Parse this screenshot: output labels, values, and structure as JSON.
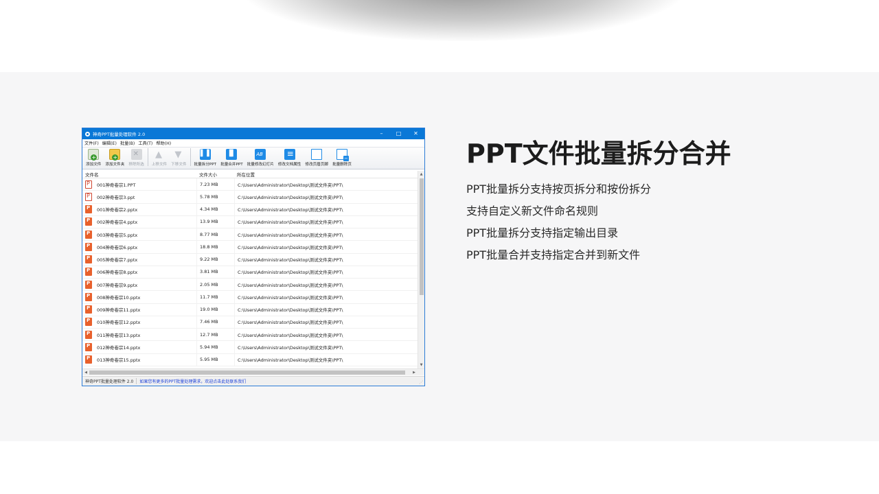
{
  "window": {
    "title": "神奇PPT批量处理软件 2.0",
    "controls": {
      "minimize": "–",
      "maximize": "□",
      "close": "✕"
    }
  },
  "menu": [
    "文件(F)",
    "编辑(E)",
    "批量(B)",
    "工具(T)",
    "帮助(H)"
  ],
  "toolbar": [
    {
      "label": "添加文件",
      "icon": "add-file-icon",
      "enabled": true
    },
    {
      "label": "添加文件夹",
      "icon": "add-folder-icon",
      "enabled": true
    },
    {
      "label": "移除所选",
      "icon": "remove-icon",
      "enabled": false
    },
    {
      "label": "上移文件",
      "icon": "move-up-icon",
      "enabled": false
    },
    {
      "label": "下移文件",
      "icon": "move-down-icon",
      "enabled": false
    },
    {
      "label": "批量拆分PPT",
      "icon": "split-icon",
      "enabled": true
    },
    {
      "label": "批量合并PPT",
      "icon": "merge-icon",
      "enabled": true
    },
    {
      "label": "批量修改幻灯片",
      "icon": "edit-slides-icon",
      "enabled": true
    },
    {
      "label": "修改文档属性",
      "icon": "doc-properties-icon",
      "enabled": true
    },
    {
      "label": "修改页眉页脚",
      "icon": "header-footer-icon",
      "enabled": true
    },
    {
      "label": "批量删除页",
      "icon": "delete-page-icon",
      "enabled": true
    }
  ],
  "table": {
    "columns": [
      "文件名",
      "文件大小",
      "所在位置"
    ],
    "rows": [
      {
        "name": "001神奇卷宗1.PPT",
        "size": "7.23 MB",
        "path": "C:\\Users\\Administrator\\Desktop\\测试文件夹\\PPT\\",
        "type": "ppt"
      },
      {
        "name": "002神奇卷宗3.ppt",
        "size": "5.78 MB",
        "path": "C:\\Users\\Administrator\\Desktop\\测试文件夹\\PPT\\",
        "type": "ppt"
      },
      {
        "name": "001神奇卷宗2.pptx",
        "size": "4.34 MB",
        "path": "C:\\Users\\Administrator\\Desktop\\测试文件夹\\PPT\\",
        "type": "pptx"
      },
      {
        "name": "002神奇卷宗4.pptx",
        "size": "13.9 MB",
        "path": "C:\\Users\\Administrator\\Desktop\\测试文件夹\\PPT\\",
        "type": "pptx"
      },
      {
        "name": "003神奇卷宗5.pptx",
        "size": "8.77 MB",
        "path": "C:\\Users\\Administrator\\Desktop\\测试文件夹\\PPT\\",
        "type": "pptx"
      },
      {
        "name": "004神奇卷宗6.pptx",
        "size": "18.8 MB",
        "path": "C:\\Users\\Administrator\\Desktop\\测试文件夹\\PPT\\",
        "type": "pptx"
      },
      {
        "name": "005神奇卷宗7.pptx",
        "size": "9.22 MB",
        "path": "C:\\Users\\Administrator\\Desktop\\测试文件夹\\PPT\\",
        "type": "pptx"
      },
      {
        "name": "006神奇卷宗8.pptx",
        "size": "3.81 MB",
        "path": "C:\\Users\\Administrator\\Desktop\\测试文件夹\\PPT\\",
        "type": "pptx"
      },
      {
        "name": "007神奇卷宗9.pptx",
        "size": "2.05 MB",
        "path": "C:\\Users\\Administrator\\Desktop\\测试文件夹\\PPT\\",
        "type": "pptx"
      },
      {
        "name": "008神奇卷宗10.pptx",
        "size": "11.7 MB",
        "path": "C:\\Users\\Administrator\\Desktop\\测试文件夹\\PPT\\",
        "type": "pptx"
      },
      {
        "name": "009神奇卷宗11.pptx",
        "size": "19.0 MB",
        "path": "C:\\Users\\Administrator\\Desktop\\测试文件夹\\PPT\\",
        "type": "pptx"
      },
      {
        "name": "010神奇卷宗12.pptx",
        "size": "7.46 MB",
        "path": "C:\\Users\\Administrator\\Desktop\\测试文件夹\\PPT\\",
        "type": "pptx"
      },
      {
        "name": "011神奇卷宗13.pptx",
        "size": "12.7 MB",
        "path": "C:\\Users\\Administrator\\Desktop\\测试文件夹\\PPT\\",
        "type": "pptx"
      },
      {
        "name": "012神奇卷宗14.pptx",
        "size": "5.94 MB",
        "path": "C:\\Users\\Administrator\\Desktop\\测试文件夹\\PPT\\",
        "type": "pptx"
      },
      {
        "name": "013神奇卷宗15.pptx",
        "size": "5.95 MB",
        "path": "C:\\Users\\Administrator\\Desktop\\测试文件夹\\PPT\\",
        "type": "pptx"
      }
    ]
  },
  "status": {
    "app": "神奇PPT批量处理软件 2.0",
    "message": "如果您有更多的PPT批量处理需求，欢迎点击此处联系我们"
  },
  "heading": "PPT文件批量拆分合并",
  "features": [
    "PPT批量拆分支持按页拆分和按份拆分",
    "支持自定义新文件命名规则",
    "PPT批量拆分支持指定输出目录",
    "PPT批量合并支持指定合并到新文件"
  ],
  "colors": {
    "titlebar": "#0a78d7",
    "band": "#f6f6f7",
    "pptx_icon": "#e8612d",
    "status_link": "#1a3fd8"
  }
}
